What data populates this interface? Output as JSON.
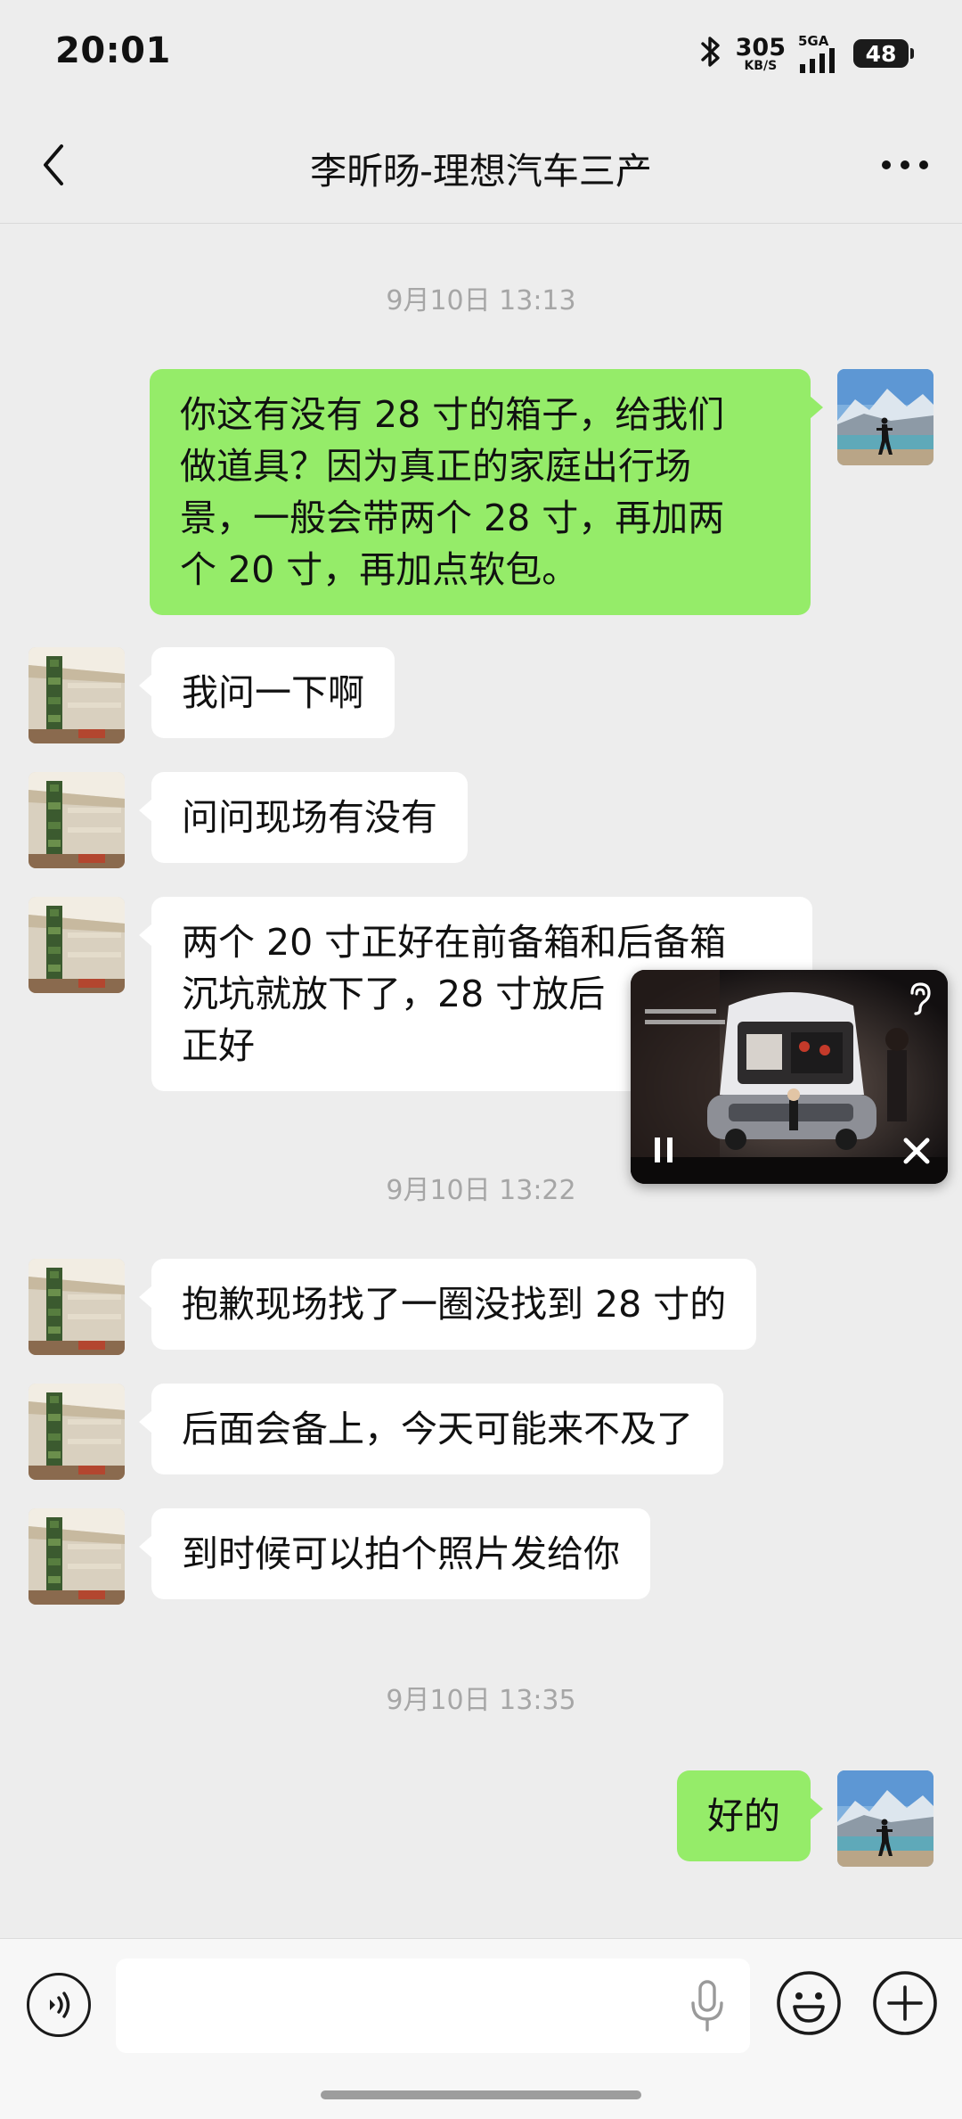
{
  "status_bar": {
    "time": "20:01",
    "net_speed_value": "305",
    "net_speed_unit": "KB/S",
    "signal_label": "5GA",
    "battery": "48",
    "icons": [
      "bluetooth-icon",
      "signal-icon",
      "battery-icon"
    ]
  },
  "header": {
    "title": "李昕旸-理想汽车三产",
    "back_icon": "chevron-left-icon",
    "more_icon": "more-dots-icon"
  },
  "messages": [
    {
      "type": "timestamp",
      "text": "9月10日 13:13"
    },
    {
      "type": "out",
      "lines": [
        "你这有没有 28 寸的箱子，给我们",
        "做道具？因为真正的家庭出行场",
        "景，一般会带两个 28 寸，再加两",
        "个 20 寸，再加点软包。"
      ]
    },
    {
      "type": "in",
      "lines": [
        "我问一下啊"
      ]
    },
    {
      "type": "in",
      "lines": [
        "问问现场有没有"
      ]
    },
    {
      "type": "in",
      "lines": [
        "两个 20 寸正好在前备箱和后备箱",
        "沉坑就放下了，28 寸放后",
        "正好"
      ]
    },
    {
      "type": "timestamp",
      "text": "9月10日 13:22"
    },
    {
      "type": "in",
      "lines": [
        "抱歉现场找了一圈没找到 28 寸的"
      ]
    },
    {
      "type": "in",
      "lines": [
        "后面会备上，今天可能来不及了"
      ]
    },
    {
      "type": "in",
      "lines": [
        "到时候可以拍个照片发给你"
      ]
    },
    {
      "type": "timestamp",
      "text": "9月10日 13:35"
    },
    {
      "type": "out",
      "lines": [
        "好的"
      ]
    }
  ],
  "floating_video": {
    "icons": [
      "hearing-icon",
      "pause-icon",
      "close-icon"
    ],
    "state": "playing"
  },
  "input_bar": {
    "voice_icon": "voice-mode-icon",
    "text_value": "",
    "mic_icon": "microphone-icon",
    "emoji_icon": "emoji-icon",
    "plus_icon": "plus-circle-icon"
  },
  "colors": {
    "background": "#ededed",
    "outgoing_bubble": "#95ec69",
    "incoming_bubble": "#ffffff",
    "timestamp_text": "#a6a6a6"
  }
}
